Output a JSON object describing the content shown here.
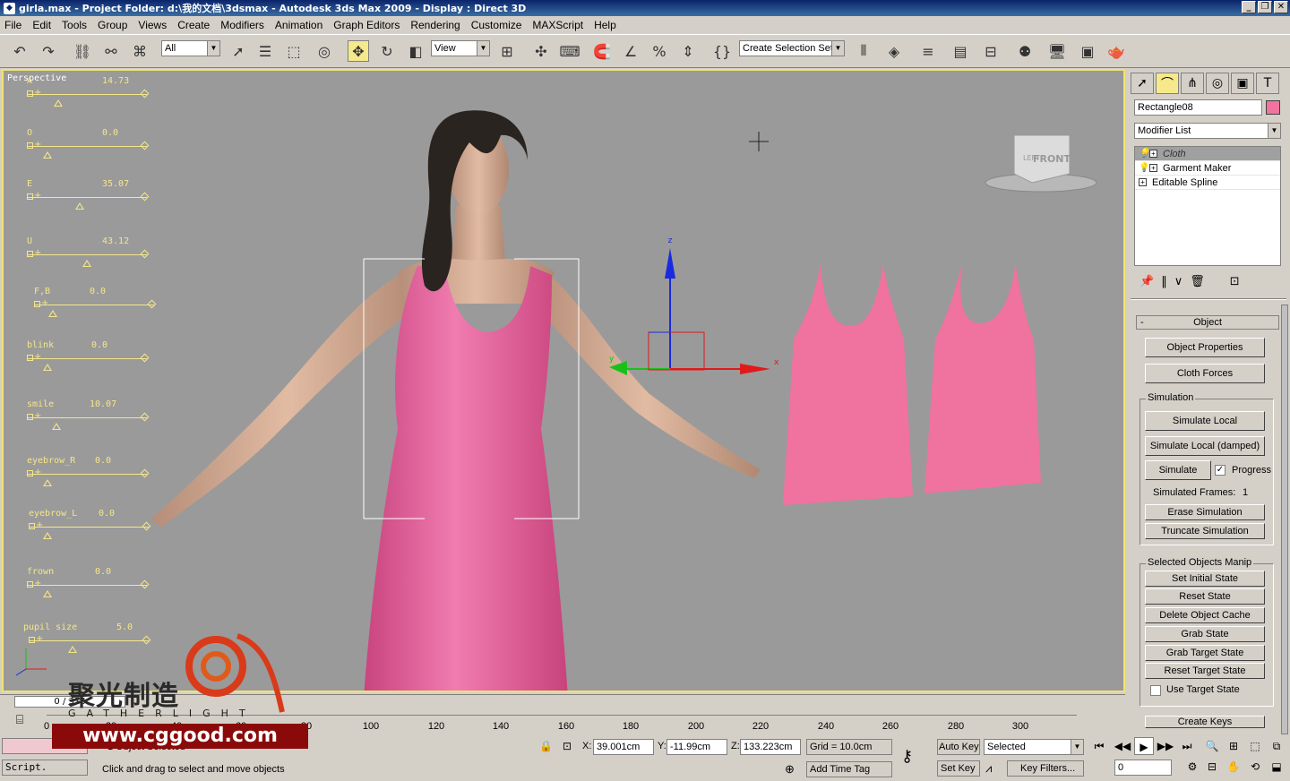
{
  "window": {
    "title": "girla.max      - Project Folder: d:\\我的文档\\3dsmax      - Autodesk 3ds Max  2009      - Display : Direct 3D",
    "min": "_",
    "max": "❐",
    "close": "✕"
  },
  "menu": [
    "File",
    "Edit",
    "Tools",
    "Group",
    "Views",
    "Create",
    "Modifiers",
    "Animation",
    "Graph Editors",
    "Rendering",
    "Customize",
    "MAXScript",
    "Help"
  ],
  "toolbar": {
    "filter_value": "All",
    "refcoord_value": "View",
    "selection_set_placeholder": "Create Selection Set"
  },
  "viewport": {
    "label": "Perspective",
    "viewcube_face": "FRONT",
    "viewcube_side": "LEFT",
    "sliders": [
      {
        "name": "A",
        "value": "14.73"
      },
      {
        "name": "O",
        "value": "0.0"
      },
      {
        "name": "E",
        "value": "35.07"
      },
      {
        "name": "U",
        "value": "43.12"
      },
      {
        "name": "F,B",
        "value": "0.0"
      },
      {
        "name": "blink",
        "value": "0.0"
      },
      {
        "name": "smile",
        "value": "10.07"
      },
      {
        "name": "eyebrow_R",
        "value": "0.0"
      },
      {
        "name": "eyebrow_L",
        "value": "0.0"
      },
      {
        "name": "frown",
        "value": "0.0"
      },
      {
        "name": "pupil size",
        "value": "5.0"
      }
    ],
    "gizmo": {
      "x": "x",
      "y": "y",
      "z": "z"
    }
  },
  "command_panel": {
    "object_name": "Rectangle08",
    "object_color": "#f2739f",
    "modifier_list": "Modifier List",
    "stack": [
      {
        "label": "Cloth",
        "selected": true
      },
      {
        "label": "Garment Maker",
        "selected": false
      },
      {
        "label": "Editable Spline",
        "selected": false
      }
    ],
    "rollout_title": "Object",
    "object_properties": "Object Properties",
    "cloth_forces": "Cloth Forces",
    "simulation_group": "Simulation",
    "simulate_local": "Simulate Local",
    "simulate_local_damped": "Simulate Local (damped)",
    "simulate": "Simulate",
    "progress": "Progress",
    "simulated_frames_label": "Simulated Frames:",
    "simulated_frames_value": "1",
    "erase_simulation": "Erase Simulation",
    "truncate_simulation": "Truncate Simulation",
    "manip_group": "Selected Objects Manip",
    "set_initial_state": "Set Initial State",
    "reset_state": "Reset State",
    "delete_object_cache": "Delete Object Cache",
    "grab_state": "Grab State",
    "grab_target_state": "Grab Target State",
    "reset_target_state": "Reset Target State",
    "use_target_state": "Use Target State",
    "create_keys": "Create Keys"
  },
  "timeline": {
    "frame_display": "0 / 316",
    "ticks": [
      "0",
      "20",
      "40",
      "60",
      "80",
      "100",
      "120",
      "140",
      "160",
      "180",
      "200",
      "220",
      "240",
      "260",
      "280",
      "300"
    ]
  },
  "status": {
    "selected_info": "1 Object Selected",
    "prompt": "Click and drag to select and move objects",
    "x_label": "X:",
    "x_value": "39.001cm",
    "y_label": "Y:",
    "y_value": "-11.99cm",
    "z_label": "Z:",
    "z_value": "133.223cm",
    "grid": "Grid = 10.0cm",
    "add_time_tag": "Add Time Tag",
    "auto_key": "Auto Key",
    "set_key": "Set Key",
    "key_mode": "Selected",
    "key_filters": "Key Filters...",
    "frame_value": "0",
    "script_label": "Script."
  },
  "watermark": {
    "title": "聚光制造",
    "gather": "GATHERLIGHT",
    "site": "www.cggood.com"
  }
}
